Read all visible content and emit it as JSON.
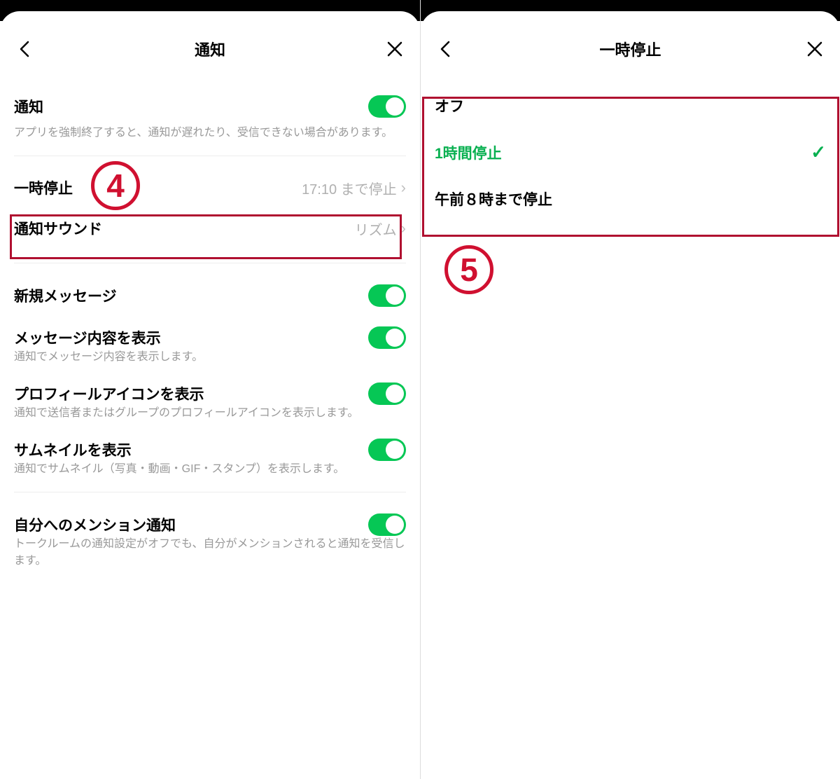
{
  "left": {
    "header": {
      "title": "通知"
    },
    "notification": {
      "label": "通知",
      "sub": "アプリを強制終了すると、通知が遅れたり、受信できない場合があります。"
    },
    "pause": {
      "label": "一時停止",
      "value": "17:10 まで停止"
    },
    "sound": {
      "label": "通知サウンド",
      "value": "リズム"
    },
    "newMessage": {
      "label": "新規メッセージ"
    },
    "showContent": {
      "label": "メッセージ内容を表示",
      "sub": "通知でメッセージ内容を表示します。"
    },
    "showProfileIcon": {
      "label": "プロフィールアイコンを表示",
      "sub": "通知で送信者またはグループのプロフィールアイコンを表示します。"
    },
    "showThumbnail": {
      "label": "サムネイルを表示",
      "sub": "通知でサムネイル（写真・動画・GIF・スタンプ）を表示します。"
    },
    "mention": {
      "label": "自分へのメンション通知",
      "sub": "トークルームの通知設定がオフでも、自分がメンションされると通知を受信します。"
    }
  },
  "right": {
    "header": {
      "title": "一時停止"
    },
    "options": {
      "off": "オフ",
      "one_hour": "1時間停止",
      "until_8am": "午前８時まで停止"
    }
  },
  "annotations": {
    "step4": "4",
    "step5": "5"
  }
}
